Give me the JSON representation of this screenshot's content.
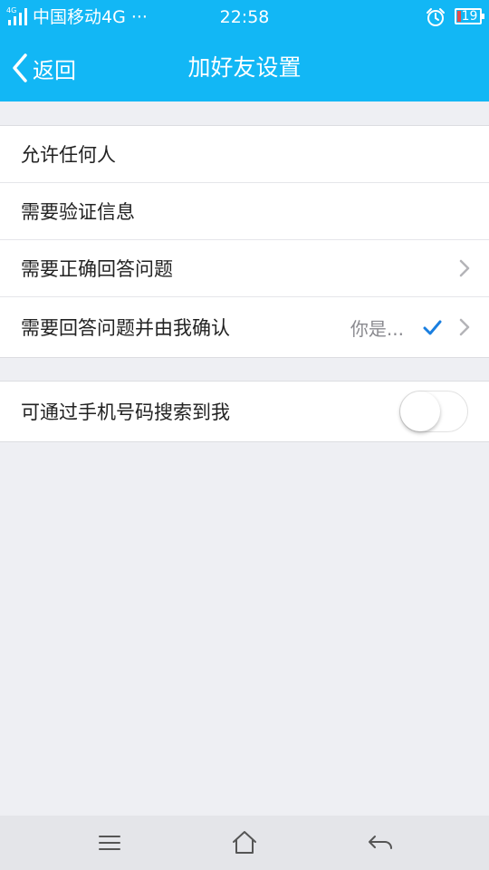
{
  "status_bar": {
    "network_type": "4G",
    "carrier": "中国移动4G ···",
    "time": "22:58",
    "battery": "19",
    "battery_low_color": "#e54b4b",
    "icons": [
      "signal-icon",
      "alarm-icon",
      "battery-icon"
    ]
  },
  "nav": {
    "back_label": "返回",
    "title": "加好友设置",
    "background_color": "#12b7f5"
  },
  "options": [
    {
      "label": "允许任何人",
      "value": "",
      "selected": false,
      "has_arrow": false
    },
    {
      "label": "需要验证信息",
      "value": "",
      "selected": false,
      "has_arrow": false
    },
    {
      "label": "需要正确回答问题",
      "value": "",
      "selected": false,
      "has_arrow": true
    },
    {
      "label": "需要回答问题并由我确认",
      "value": "你是...",
      "selected": true,
      "has_arrow": true
    }
  ],
  "phone_search": {
    "label": "可通过手机号码搜索到我",
    "enabled": false
  },
  "system_nav": {
    "icons": [
      "menu-icon",
      "home-icon",
      "back-arrow-icon"
    ]
  },
  "colors": {
    "accent": "#12b7f5",
    "check": "#1a7fe0",
    "background": "#eeeff3"
  }
}
